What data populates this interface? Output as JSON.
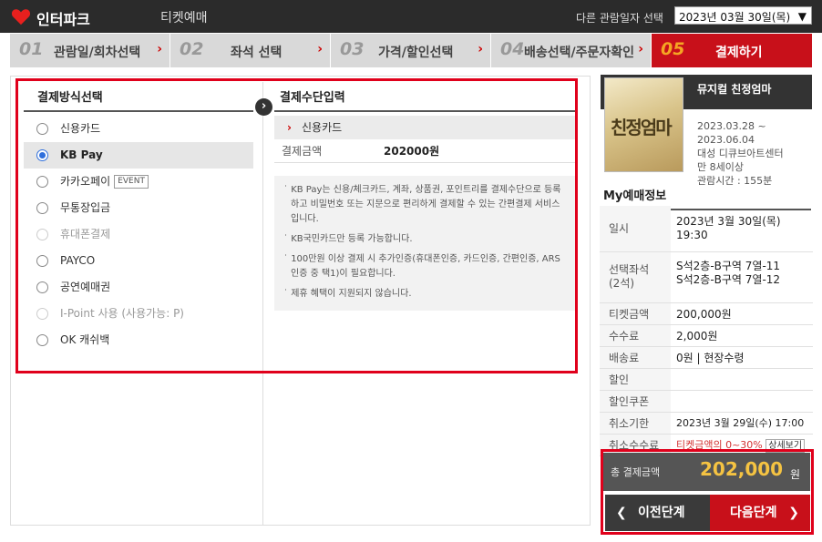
{
  "header": {
    "brand": "인터파크",
    "brand_sub": "티켓예매",
    "date_label": "다른 관람일자 선택",
    "date_value": "2023년 03월 30일(목)"
  },
  "steps": [
    {
      "num": "01",
      "label": "관람일/회차선택",
      "active": false
    },
    {
      "num": "02",
      "label": "좌석 선택",
      "active": false
    },
    {
      "num": "03",
      "label": "가격/할인선택",
      "active": false
    },
    {
      "num": "04",
      "label": "배송선택/주문자확인",
      "active": false
    },
    {
      "num": "05",
      "label": "결제하기",
      "active": true
    }
  ],
  "payment_methods": {
    "title": "결제방식선택",
    "items": [
      {
        "label": "신용카드",
        "state": "normal"
      },
      {
        "label": "KB Pay",
        "state": "selected"
      },
      {
        "label": "카카오페이",
        "state": "normal",
        "badge": "EVENT"
      },
      {
        "label": "무통장입금",
        "state": "normal"
      },
      {
        "label": "휴대폰결제",
        "state": "disabled"
      },
      {
        "label": "PAYCO",
        "state": "normal"
      },
      {
        "label": "공연예매권",
        "state": "normal"
      },
      {
        "label": "I-Point 사용 (사용가능: P)",
        "state": "disabled"
      },
      {
        "label": "OK 캐쉬백",
        "state": "normal"
      }
    ]
  },
  "payment_input": {
    "title": "결제수단입력",
    "method": "신용카드",
    "amount_label": "결제금액",
    "amount_value": "202000원",
    "notes": [
      "KB Pay는 신용/체크카드, 계좌, 상품권, 포인트리를 결제수단으로 등록하고 비밀번호 또는 지문으로 편리하게 결제할 수 있는 간편결제 서비스입니다.",
      "KB국민카드만 등록 가능합니다.",
      "100만원 이상 결제 시 추가인증(휴대폰인증, 카드인증, 간편인증, ARS인증 중 택1)이 필요합니다.",
      "제휴 혜택이 지원되지 않습니다."
    ]
  },
  "show": {
    "title": "뮤지컬 친정엄마",
    "poster_text": "친정엄마",
    "period_start": "2023.03.28 ~",
    "period_end": "2023.06.04",
    "venue": "대성 디큐브아트센터",
    "age": "만 8세이상",
    "runtime": "관람시간 : 155분"
  },
  "my_booking": {
    "title": "My예매정보",
    "rows": [
      {
        "key": "일시",
        "value": "2023년 3월 30일(목)\n19:30"
      },
      {
        "key": "선택좌석\n(2석)",
        "value": "S석2층-B구역 7열-11\nS석2층-B구역 7열-12"
      },
      {
        "key": "티켓금액",
        "value": "200,000원"
      },
      {
        "key": "수수료",
        "value": "2,000원"
      },
      {
        "key": "배송료",
        "value": "0원 | 현장수령"
      },
      {
        "key": "할인",
        "value": ""
      },
      {
        "key": "할인쿠폰",
        "value": ""
      },
      {
        "key": "취소기한",
        "value": "2023년 3월 29일(수) 17:00"
      },
      {
        "key": "취소수수료",
        "value": "티켓금액의 0~30%",
        "button": "상세보기"
      }
    ]
  },
  "total": {
    "label": "총 결제금액",
    "value": "202,000",
    "unit": "원"
  },
  "buttons": {
    "prev": "이전단계",
    "next": "다음단계"
  },
  "colors": {
    "accent_red": "#c8101a",
    "highlight_box": "#e0001b",
    "total_gold": "#f5c342"
  }
}
